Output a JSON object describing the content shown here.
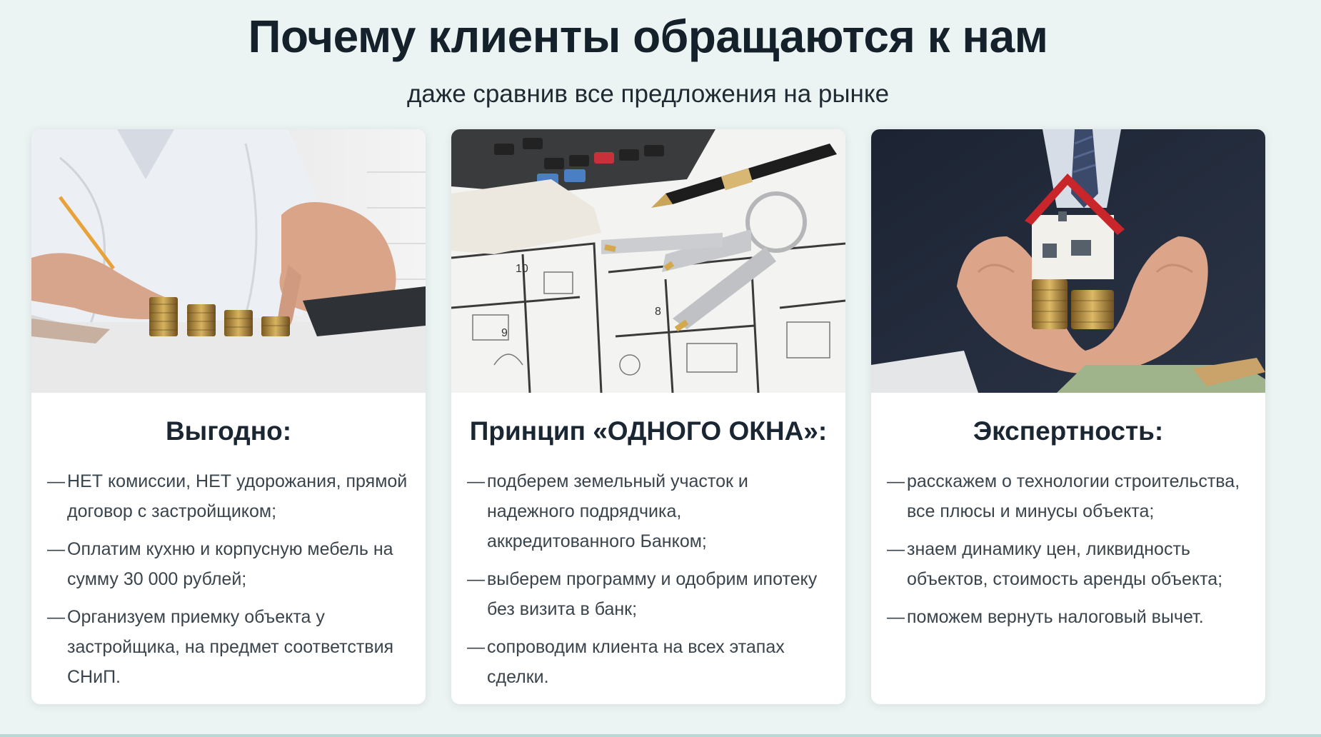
{
  "header": {
    "title": "Почему клиенты обращаются к нам",
    "subtitle": "даже сравнив все предложения на рынке"
  },
  "cards": [
    {
      "title": "Выгодно:",
      "image_icon": "coins-stack-photo",
      "items": [
        "НЕТ комиссии, НЕТ удорожания, прямой договор с застройщиком;",
        "Оплатим кухню и корпусную мебель на сумму 30 000 рублей;",
        "Организуем приемку объекта у застройщика, на предмет соответствия СНиП."
      ]
    },
    {
      "title": "Принцип «ОДНОГО ОКНА»:",
      "image_icon": "keys-blueprint-photo",
      "items": [
        "подберем земельный участок и надежного подрядчика, аккредитованного Банком;",
        "выберем программу и одобрим ипотеку без визита в банк;",
        "сопроводим клиента на всех этапах сделки."
      ]
    },
    {
      "title": "Экспертность:",
      "image_icon": "house-in-hands-photo",
      "items": [
        "расскажем о технологии строительства, все плюсы и минусы объекта;",
        "знаем динамику цен, ликвидность объектов, стоимость аренды объекта;",
        "поможем вернуть налоговый вычет."
      ]
    }
  ],
  "list_marker": "—",
  "colors": {
    "background": "#ecf4f3",
    "card": "#ffffff",
    "title": "#14212b",
    "text": "#3a444c"
  }
}
